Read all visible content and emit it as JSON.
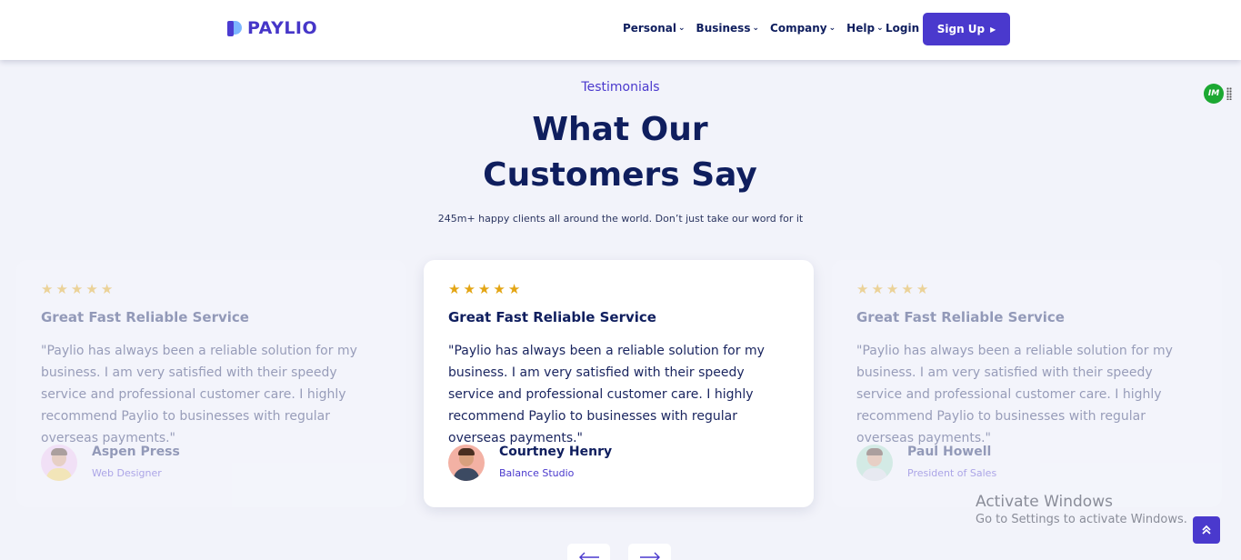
{
  "brand": {
    "name": "PAYLIO"
  },
  "nav": {
    "items": [
      {
        "label": "Personal"
      },
      {
        "label": "Business"
      },
      {
        "label": "Company"
      },
      {
        "label": "Help"
      }
    ],
    "login_label": "Login",
    "signup_label": "Sign Up"
  },
  "extension_badge": "IM",
  "section": {
    "eyebrow": "Testimonials",
    "heading": "What Our Customers Say",
    "subtext": "245m+ happy clients all around the world. Don’t just take our word for it"
  },
  "testimonials": [
    {
      "rating": 5,
      "title": "Great Fast Reliable Service",
      "quote": "\"Paylio has always been a reliable solution for my business. I am very satisfied with their speedy service and professional customer care. I highly recommend Paylio to businesses with regular overseas payments.\"",
      "name": "Aspen Press",
      "role": "Web Designer"
    },
    {
      "rating": 5,
      "title": "Great Fast Reliable Service",
      "quote": "\"Paylio has always been a reliable solution for my business. I am very satisfied with their speedy service and professional customer care. I highly recommend Paylio to businesses with regular overseas payments.\"",
      "name": "Courtney Henry",
      "role": "Balance Studio"
    },
    {
      "rating": 5,
      "title": "Great Fast Reliable Service",
      "quote": "\"Paylio has always been a reliable solution for my business. I am very satisfied with their speedy service and professional customer care. I highly recommend Paylio to businesses with regular overseas payments.\"",
      "name": "Paul Howell",
      "role": "President of Sales"
    }
  ],
  "watermark": {
    "title": "Activate Windows",
    "subtitle": "Go to Settings to activate Windows."
  },
  "colors": {
    "accent": "#4a39cd",
    "navy": "#0f1e5e",
    "star": "#e3a514",
    "background": "#f2f3fa"
  }
}
